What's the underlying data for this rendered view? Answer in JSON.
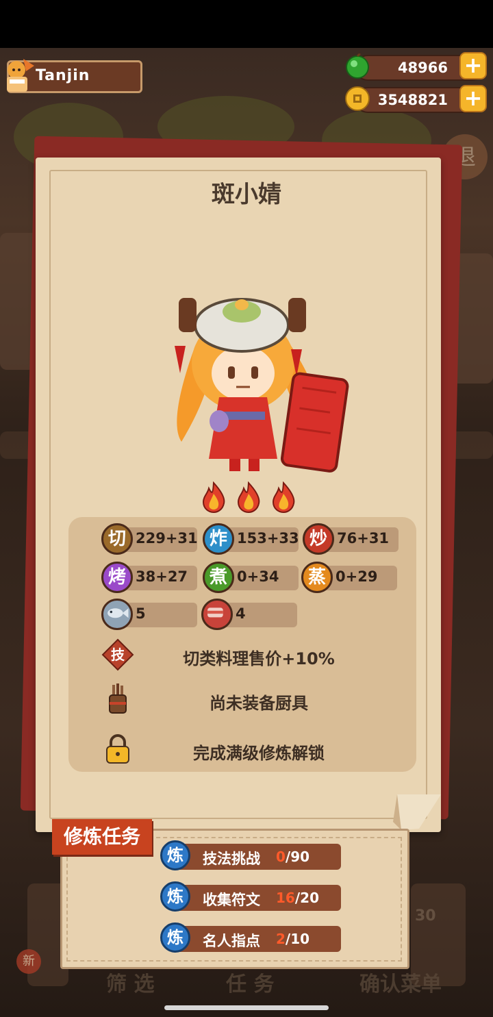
{
  "hud": {
    "player_name": "Tanjin",
    "gems": "48966",
    "coins": "3548821",
    "plus_label": "+"
  },
  "character": {
    "name": "斑小婧",
    "star_count": 3
  },
  "stats": [
    {
      "icon_char": "切",
      "value": "229+31",
      "color": "#9a6a2a"
    },
    {
      "icon_char": "炸",
      "value": "153+33",
      "color": "#2d8fc9"
    },
    {
      "icon_char": "炒",
      "value": "76+31",
      "color": "#c43a28"
    },
    {
      "icon_char": "烤",
      "value": "38+27",
      "color": "#9a4ac9"
    },
    {
      "icon_char": "煮",
      "value": "0+34",
      "color": "#4a9a2a"
    },
    {
      "icon_char": "蒸",
      "value": "0+29",
      "color": "#e48a1e"
    },
    {
      "icon_char": "fish",
      "value": "5",
      "color": "#8fa3b5"
    },
    {
      "icon_char": "meat",
      "value": "4",
      "color": "#c8433a"
    }
  ],
  "skill": {
    "icon_char": "技",
    "text": "切类料理售价+10%"
  },
  "equipment": {
    "text": "尚未装备厨具"
  },
  "locked": {
    "text": "完成满级修炼解锁"
  },
  "training": {
    "title": "修炼任务",
    "icon_char": "炼",
    "tasks": [
      {
        "label": "技法挑战",
        "current": "0",
        "total": "/90"
      },
      {
        "label": "收集符文",
        "current": "16",
        "total": "/20"
      },
      {
        "label": "名人指点",
        "current": "2",
        "total": "/10"
      }
    ]
  },
  "background": {
    "new_badge": "新",
    "filter": "筛 选",
    "task": "任 务",
    "confirm_menu": "确认菜单",
    "side_count": "30",
    "back": "退"
  }
}
